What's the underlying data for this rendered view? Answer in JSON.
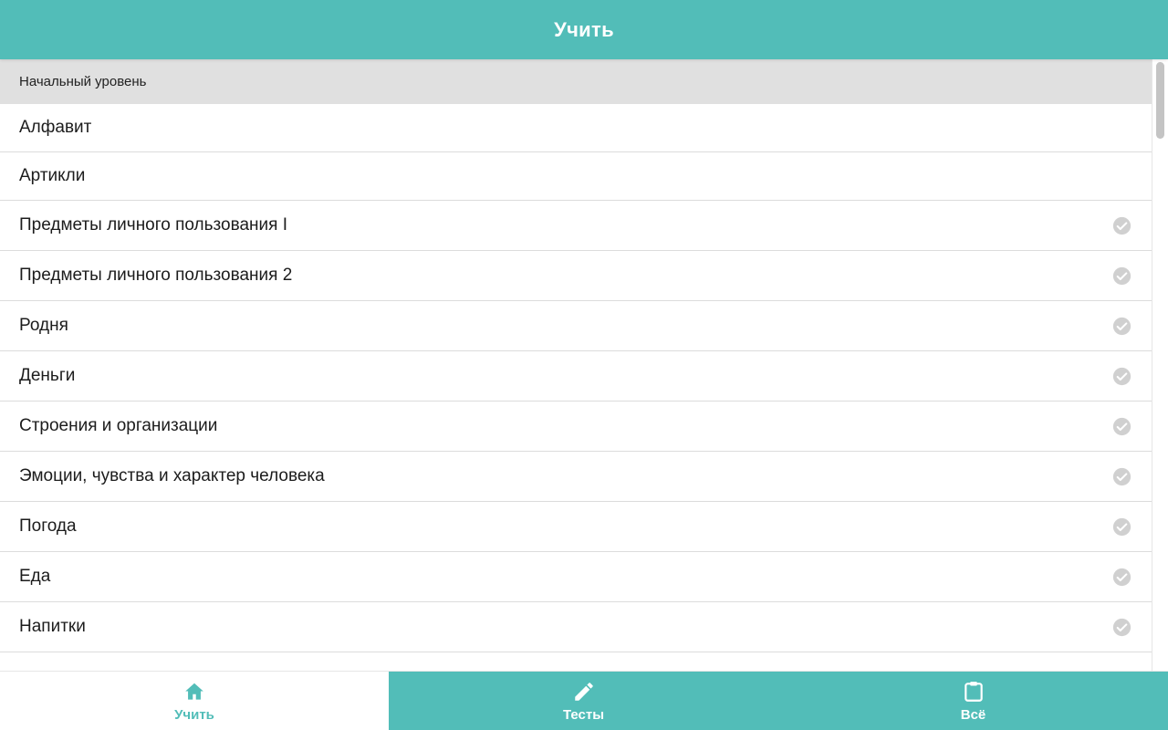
{
  "header": {
    "title": "Учить"
  },
  "section": {
    "title": "Начальный уровень"
  },
  "items": [
    {
      "label": "Алфавит",
      "completed": false
    },
    {
      "label": "Артикли",
      "completed": false
    },
    {
      "label": "Предметы личного пользования I",
      "completed": true
    },
    {
      "label": "Предметы личного пользования 2",
      "completed": true
    },
    {
      "label": "Родня",
      "completed": true
    },
    {
      "label": "Деньги",
      "completed": true
    },
    {
      "label": "Строения и организации",
      "completed": true
    },
    {
      "label": "Эмоции, чувства и характер человека",
      "completed": true
    },
    {
      "label": "Погода",
      "completed": true
    },
    {
      "label": "Еда",
      "completed": true
    },
    {
      "label": "Напитки",
      "completed": true
    }
  ],
  "nav": {
    "tabs": [
      {
        "label": "Учить",
        "icon": "home-icon",
        "active": true
      },
      {
        "label": "Тесты",
        "icon": "pencil-icon",
        "active": false
      },
      {
        "label": "Всё",
        "icon": "clipboard-icon",
        "active": false
      }
    ]
  },
  "colors": {
    "accent": "#52bdb8",
    "section_bg": "#e0e0e0",
    "check": "#d0d0d0"
  }
}
